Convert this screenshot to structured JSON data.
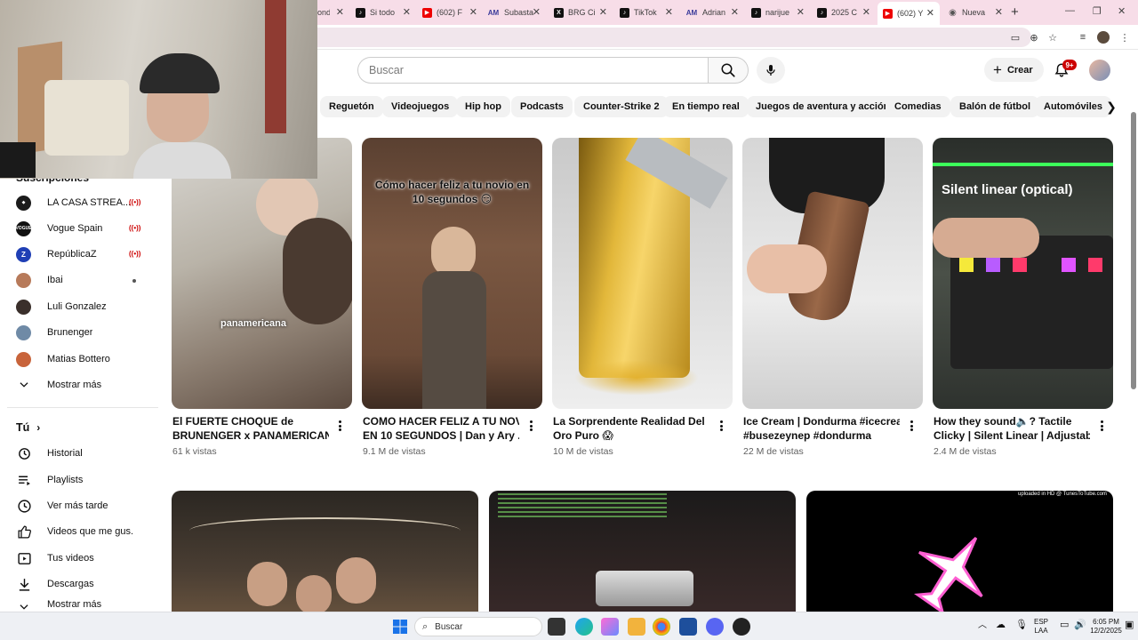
{
  "browser": {
    "tabs": [
      {
        "label": "Si todo",
        "icon": "tiktok-icon"
      },
      {
        "label": "(602) F",
        "icon": "youtube-icon"
      },
      {
        "label": "Subasta",
        "icon": "am-icon"
      },
      {
        "label": "BRG Ci",
        "icon": "x-icon"
      },
      {
        "label": "TikTok",
        "icon": "tiktok-icon"
      },
      {
        "label": "Adrian",
        "icon": "am-icon"
      },
      {
        "label": "narijue",
        "icon": "tiktok-icon"
      },
      {
        "label": "2025 C",
        "icon": "tiktok-icon"
      },
      {
        "label": "(602) Y",
        "icon": "youtube-icon",
        "active": true
      },
      {
        "label": "Nueva",
        "icon": "chrome-icon"
      }
    ],
    "partial_tab_label": "ondi"
  },
  "header": {
    "search_placeholder": "Buscar",
    "create_label": "Crear",
    "notifications_badge": "9+"
  },
  "chips": [
    "Reguetón",
    "Videojuegos",
    "Hip hop",
    "Podcasts",
    "Counter-Strike 2",
    "En tiempo real",
    "Juegos de aventura y acción",
    "Comedias",
    "Balón de fútbol",
    "Automóviles"
  ],
  "sidebar": {
    "subscriptions_label": "Suscripciones",
    "subscriptions": [
      {
        "label": "LA CASA STREA...",
        "status": "live",
        "color": "#1b1b1b",
        "initials": "LC"
      },
      {
        "label": "Vogue Spain",
        "status": "live",
        "color": "#111111",
        "initials": "VOGUE"
      },
      {
        "label": "RepúblicaZ",
        "status": "live",
        "color": "#1f3fb5",
        "initials": "Z"
      },
      {
        "label": "Ibai",
        "status": "dot",
        "color": "#b77a5a",
        "initials": ""
      },
      {
        "label": "Luli Gonzalez",
        "status": "",
        "color": "#3a2f2b",
        "initials": ""
      },
      {
        "label": "Brunenger",
        "status": "",
        "color": "#6f8aa6",
        "initials": ""
      },
      {
        "label": "Matias Bottero",
        "status": "",
        "color": "#c8643b",
        "initials": ""
      }
    ],
    "show_more": "Mostrar más",
    "you_label": "Tú",
    "you_items": [
      {
        "label": "Historial",
        "icon": "history-icon"
      },
      {
        "label": "Playlists",
        "icon": "playlists-icon"
      },
      {
        "label": "Ver más tarde",
        "icon": "watch-later-icon"
      },
      {
        "label": "Videos que me gus...",
        "icon": "like-icon"
      },
      {
        "label": "Tus videos",
        "icon": "your-videos-icon"
      },
      {
        "label": "Descargas",
        "icon": "downloads-icon"
      }
    ],
    "show_more_2": "Mostrar más"
  },
  "videos": [
    {
      "title1": "El FUERTE CHOQUE de",
      "title2": "BRUNENGER x PANAMERICAN...",
      "meta": "61 k vistas",
      "overlay": "panamericana"
    },
    {
      "title1": "COMO HACER FELIZ A TU NOVIO",
      "title2": "EN 10 SEGUNDOS | Dan y Ary ...",
      "meta": "9.1 M de vistas",
      "overlay": "Cómo hacer feliz a tu novio en 10 segundos 😏"
    },
    {
      "title1": "La Sorprendente Realidad Del",
      "title2": "Oro Puro 😱",
      "meta": "10 M de vistas",
      "overlay": ""
    },
    {
      "title1": "Ice Cream | Dondurma #icecream",
      "title2": "#busezeynep #dondurma",
      "meta": "22 M de vistas",
      "overlay": ""
    },
    {
      "title1": "How they sound🔈? Tactile",
      "title2": "Clicky | Silent Linear | Adjustabl...",
      "meta": "2.4 M de vistas",
      "overlay": "Silent linear (optical)"
    }
  ],
  "row2_overlay": "uploaded in HD @ TunesToTube.com",
  "taskbar": {
    "search_label": "Buscar",
    "lang1": "ESP",
    "lang2": "LAA",
    "time": "6:05 PM",
    "date": "12/2/2025"
  }
}
